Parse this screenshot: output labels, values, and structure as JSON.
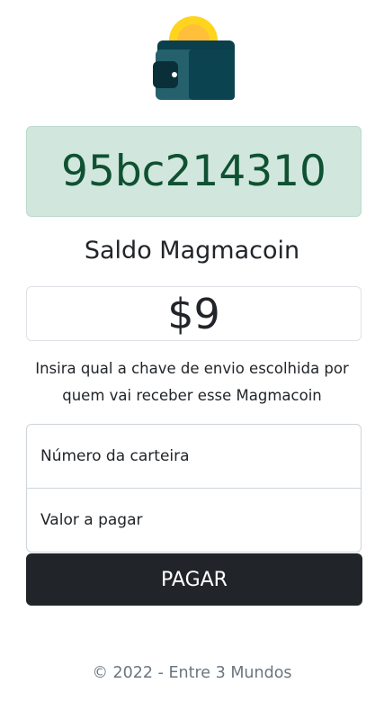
{
  "app": {
    "logo_icon": "wallet-with-coin-icon"
  },
  "wallet": {
    "id": "95bc214310"
  },
  "balance": {
    "title": "Saldo Magmacoin",
    "value": "$9"
  },
  "instructions": "Insira qual a chave de envio escolhida por quem vai receber esse Magmacoin",
  "form": {
    "wallet_placeholder": "Número da carteira",
    "amount_placeholder": "Valor a pagar",
    "submit_label": "PAGAR"
  },
  "footer": {
    "text": "© 2022 - Entre 3 Mundos"
  },
  "colors": {
    "success_bg": "#d1e7dd",
    "success_text": "#0f5132",
    "dark_button": "#212529",
    "muted_text": "#6c757d"
  }
}
